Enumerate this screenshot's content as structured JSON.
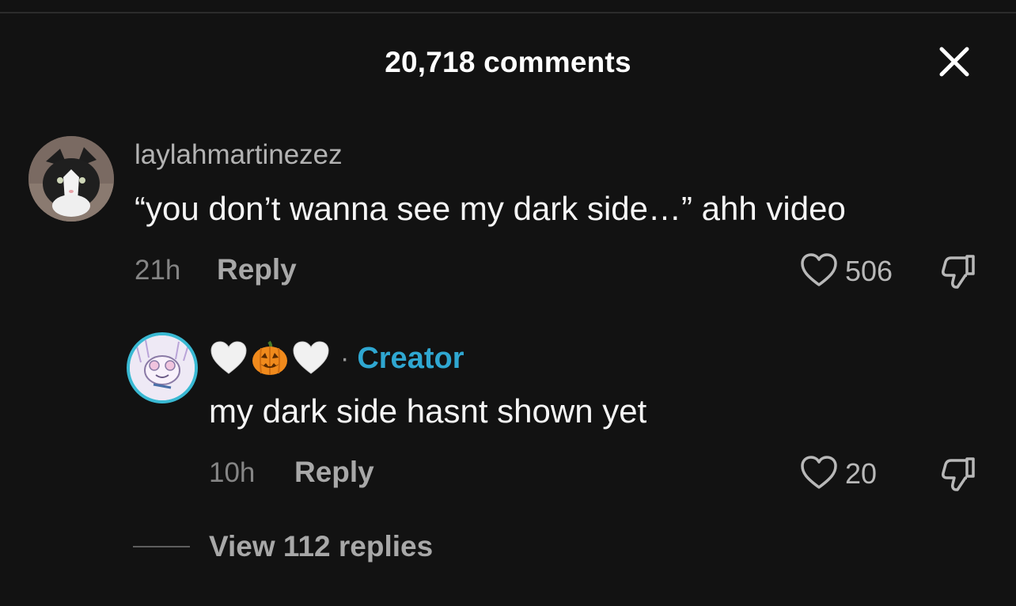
{
  "header": {
    "title": "20,718 comments",
    "close_icon": "close-icon"
  },
  "comment": {
    "username": "laylahmartinezez",
    "text": "“you don’t wanna see my dark side…” ahh video",
    "time": "21h",
    "reply_label": "Reply",
    "likes": "506",
    "like_icon": "heart-outline-icon",
    "dislike_icon": "thumbs-down-icon",
    "avatar": "cat-avatar"
  },
  "reply": {
    "name_emojis": [
      "white-heart-icon",
      "jack-o-lantern-icon",
      "white-heart-icon"
    ],
    "separator": "·",
    "badge": "Creator",
    "text": "my dark side hasnt shown yet",
    "time": "10h",
    "reply_label": "Reply",
    "likes": "20",
    "like_icon": "heart-outline-icon",
    "dislike_icon": "thumbs-down-icon",
    "avatar": "creator-avatar",
    "avatar_ring_color": "#39b9d3",
    "badge_color": "#2fa7d1"
  },
  "view_replies": {
    "label": "View 112 replies"
  },
  "colors": {
    "background": "#121212",
    "primary_text": "#f5f5f5",
    "secondary_text": "#a8a8a8"
  }
}
